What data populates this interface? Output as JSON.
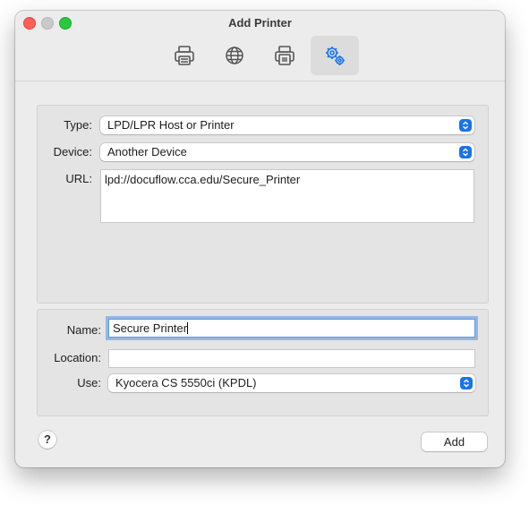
{
  "window": {
    "title": "Add Printer"
  },
  "toolbar": {
    "items": [
      {
        "icon": "printer-icon"
      },
      {
        "icon": "globe-icon"
      },
      {
        "icon": "printer-alt-icon"
      },
      {
        "icon": "gears-icon",
        "selected": true
      }
    ]
  },
  "connection": {
    "type_label": "Type:",
    "type_value": "LPD/LPR Host or Printer",
    "device_label": "Device:",
    "device_value": "Another Device",
    "url_label": "URL:",
    "url_value": "lpd://docuflow.cca.edu/Secure_Printer"
  },
  "printer": {
    "name_label": "Name:",
    "name_value": "Secure Printer",
    "location_label": "Location:",
    "location_value": "",
    "use_label": "Use:",
    "use_value": "Kyocera CS 5550ci (KPDL)"
  },
  "footer": {
    "help_label": "?",
    "add_label": "Add"
  },
  "colors": {
    "accent": "#1a73e8",
    "close": "#fe5f57",
    "minimize": "#c9c9c9",
    "maximize": "#28c840"
  }
}
